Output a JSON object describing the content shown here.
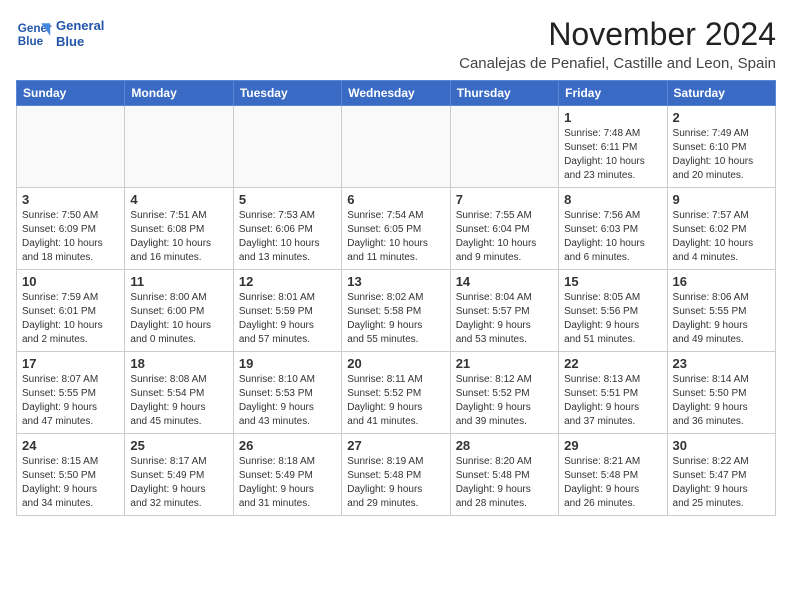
{
  "logo": {
    "line1": "General",
    "line2": "Blue"
  },
  "title": "November 2024",
  "location": "Canalejas de Penafiel, Castille and Leon, Spain",
  "headers": [
    "Sunday",
    "Monday",
    "Tuesday",
    "Wednesday",
    "Thursday",
    "Friday",
    "Saturday"
  ],
  "weeks": [
    [
      {
        "day": "",
        "info": ""
      },
      {
        "day": "",
        "info": ""
      },
      {
        "day": "",
        "info": ""
      },
      {
        "day": "",
        "info": ""
      },
      {
        "day": "",
        "info": ""
      },
      {
        "day": "1",
        "info": "Sunrise: 7:48 AM\nSunset: 6:11 PM\nDaylight: 10 hours\nand 23 minutes."
      },
      {
        "day": "2",
        "info": "Sunrise: 7:49 AM\nSunset: 6:10 PM\nDaylight: 10 hours\nand 20 minutes."
      }
    ],
    [
      {
        "day": "3",
        "info": "Sunrise: 7:50 AM\nSunset: 6:09 PM\nDaylight: 10 hours\nand 18 minutes."
      },
      {
        "day": "4",
        "info": "Sunrise: 7:51 AM\nSunset: 6:08 PM\nDaylight: 10 hours\nand 16 minutes."
      },
      {
        "day": "5",
        "info": "Sunrise: 7:53 AM\nSunset: 6:06 PM\nDaylight: 10 hours\nand 13 minutes."
      },
      {
        "day": "6",
        "info": "Sunrise: 7:54 AM\nSunset: 6:05 PM\nDaylight: 10 hours\nand 11 minutes."
      },
      {
        "day": "7",
        "info": "Sunrise: 7:55 AM\nSunset: 6:04 PM\nDaylight: 10 hours\nand 9 minutes."
      },
      {
        "day": "8",
        "info": "Sunrise: 7:56 AM\nSunset: 6:03 PM\nDaylight: 10 hours\nand 6 minutes."
      },
      {
        "day": "9",
        "info": "Sunrise: 7:57 AM\nSunset: 6:02 PM\nDaylight: 10 hours\nand 4 minutes."
      }
    ],
    [
      {
        "day": "10",
        "info": "Sunrise: 7:59 AM\nSunset: 6:01 PM\nDaylight: 10 hours\nand 2 minutes."
      },
      {
        "day": "11",
        "info": "Sunrise: 8:00 AM\nSunset: 6:00 PM\nDaylight: 10 hours\nand 0 minutes."
      },
      {
        "day": "12",
        "info": "Sunrise: 8:01 AM\nSunset: 5:59 PM\nDaylight: 9 hours\nand 57 minutes."
      },
      {
        "day": "13",
        "info": "Sunrise: 8:02 AM\nSunset: 5:58 PM\nDaylight: 9 hours\nand 55 minutes."
      },
      {
        "day": "14",
        "info": "Sunrise: 8:04 AM\nSunset: 5:57 PM\nDaylight: 9 hours\nand 53 minutes."
      },
      {
        "day": "15",
        "info": "Sunrise: 8:05 AM\nSunset: 5:56 PM\nDaylight: 9 hours\nand 51 minutes."
      },
      {
        "day": "16",
        "info": "Sunrise: 8:06 AM\nSunset: 5:55 PM\nDaylight: 9 hours\nand 49 minutes."
      }
    ],
    [
      {
        "day": "17",
        "info": "Sunrise: 8:07 AM\nSunset: 5:55 PM\nDaylight: 9 hours\nand 47 minutes."
      },
      {
        "day": "18",
        "info": "Sunrise: 8:08 AM\nSunset: 5:54 PM\nDaylight: 9 hours\nand 45 minutes."
      },
      {
        "day": "19",
        "info": "Sunrise: 8:10 AM\nSunset: 5:53 PM\nDaylight: 9 hours\nand 43 minutes."
      },
      {
        "day": "20",
        "info": "Sunrise: 8:11 AM\nSunset: 5:52 PM\nDaylight: 9 hours\nand 41 minutes."
      },
      {
        "day": "21",
        "info": "Sunrise: 8:12 AM\nSunset: 5:52 PM\nDaylight: 9 hours\nand 39 minutes."
      },
      {
        "day": "22",
        "info": "Sunrise: 8:13 AM\nSunset: 5:51 PM\nDaylight: 9 hours\nand 37 minutes."
      },
      {
        "day": "23",
        "info": "Sunrise: 8:14 AM\nSunset: 5:50 PM\nDaylight: 9 hours\nand 36 minutes."
      }
    ],
    [
      {
        "day": "24",
        "info": "Sunrise: 8:15 AM\nSunset: 5:50 PM\nDaylight: 9 hours\nand 34 minutes."
      },
      {
        "day": "25",
        "info": "Sunrise: 8:17 AM\nSunset: 5:49 PM\nDaylight: 9 hours\nand 32 minutes."
      },
      {
        "day": "26",
        "info": "Sunrise: 8:18 AM\nSunset: 5:49 PM\nDaylight: 9 hours\nand 31 minutes."
      },
      {
        "day": "27",
        "info": "Sunrise: 8:19 AM\nSunset: 5:48 PM\nDaylight: 9 hours\nand 29 minutes."
      },
      {
        "day": "28",
        "info": "Sunrise: 8:20 AM\nSunset: 5:48 PM\nDaylight: 9 hours\nand 28 minutes."
      },
      {
        "day": "29",
        "info": "Sunrise: 8:21 AM\nSunset: 5:48 PM\nDaylight: 9 hours\nand 26 minutes."
      },
      {
        "day": "30",
        "info": "Sunrise: 8:22 AM\nSunset: 5:47 PM\nDaylight: 9 hours\nand 25 minutes."
      }
    ]
  ]
}
